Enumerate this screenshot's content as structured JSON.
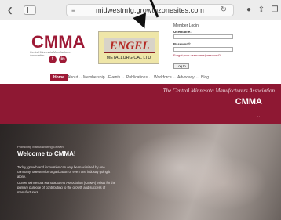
{
  "browser": {
    "url": "midwestmfg.growthzonesites.com",
    "icons": [
      "chevron-left-icon",
      "sidebar-icon",
      "menu-icon",
      "reload-icon",
      "record-icon",
      "share-icon",
      "tabs-icon"
    ]
  },
  "header": {
    "logo_text": "CMMA",
    "logo_subtext": "Central Minnesota Manufacturers Association",
    "social": [
      {
        "icon": "facebook-icon",
        "glyph": "f"
      },
      {
        "icon": "linkedin-icon",
        "glyph": "in"
      }
    ],
    "sponsor": {
      "word": "ENGEL",
      "sub": "METALLURGICAL LTD"
    },
    "login": {
      "title": "Member Login",
      "username_label": "Username:",
      "password_label": "Password:",
      "forgot": "Forgot your username/password?",
      "button": "Log In"
    }
  },
  "nav": {
    "home": "Home",
    "items": [
      "About ⌄",
      "Membership ⌄",
      "Events ⌄",
      "Publications ⌄",
      "Workforce ⌄",
      "Advocacy ⌄",
      "Blog"
    ]
  },
  "banner": {
    "association": "The Central Minnesota Manufacturers Association",
    "acronym": "CMMA",
    "chevron": "⌄"
  },
  "hero": {
    "kicker": "Promoting Manufacturing Growth",
    "title": "Welcome to CMMA!",
    "p1": "Today, growth and innovation can only be maximized by one company, one service organization or even one industry going it alone.",
    "p2": "OurMe Minnesota Manufacturers Association (CMMA) exists for the primary purpose of contributing to the growth and success of manufacturers."
  },
  "colors": {
    "brand": "#9e1a36",
    "banner": "#8e1833"
  }
}
